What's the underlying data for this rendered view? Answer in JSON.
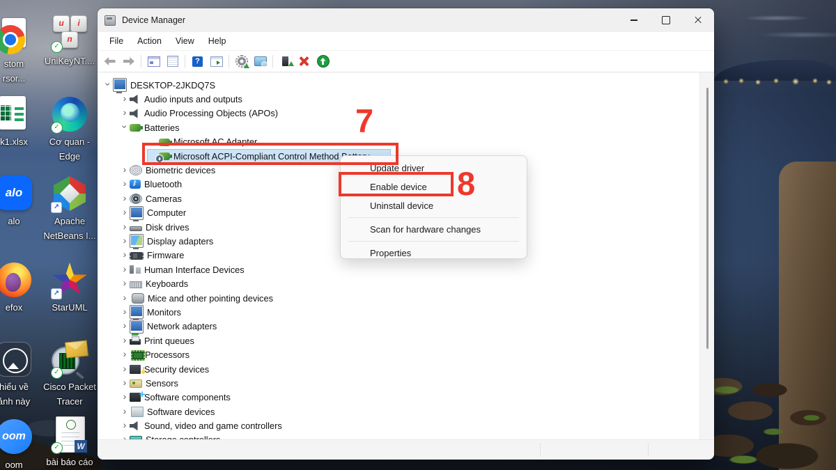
{
  "colors": {
    "annotation_red": "#ee382c",
    "selection_blue": "#cce4f7",
    "menu_bg": "#f9f9f9",
    "titlebar_bg": "#f0f0f0"
  },
  "annotations": {
    "step7": "7",
    "step8": "8"
  },
  "desktop": {
    "icons": [
      {
        "name": "custom-cursor-shortcut",
        "icon": "chrome-page-icon",
        "line1": "stom",
        "line2": "rsor..."
      },
      {
        "name": "unikey-shortcut",
        "icon": "unikey-keys-icon",
        "line1": "UniKeyNT....",
        "line2": "",
        "key1": "u",
        "key2": "i",
        "key3": "n"
      },
      {
        "name": "excel-file",
        "icon": "excel-file-icon",
        "line1": "k1.xlsx",
        "line2": ""
      },
      {
        "name": "edge-shortcut",
        "icon": "edge-icon",
        "line1": "Cơ quan -",
        "line2": "Edge"
      },
      {
        "name": "zalo-shortcut",
        "icon": "zalo-icon",
        "line1": "alo",
        "line2": "",
        "icon_text": "alo"
      },
      {
        "name": "netbeans-shortcut",
        "icon": "netbeans-cube-icon",
        "line1": "Apache",
        "line2": "NetBeans I..."
      },
      {
        "name": "firefox-shortcut",
        "icon": "firefox-icon",
        "line1": "efox",
        "line2": ""
      },
      {
        "name": "staruml-shortcut",
        "icon": "staruml-star-icon",
        "line1": "StarUML",
        "line2": ""
      },
      {
        "name": "photo-file",
        "icon": "photo-viewer-icon",
        "line1": "hiểu về",
        "line2": "ảnh này"
      },
      {
        "name": "cisco-packet-tracer-shortcut",
        "icon": "cisco-packet-tracer-icon",
        "line1": "Cisco Packet",
        "line2": "Tracer"
      },
      {
        "name": "zoom-shortcut",
        "icon": "zoom-icon",
        "line1": "oom",
        "line2": "",
        "icon_text": "oom"
      },
      {
        "name": "word-report-file",
        "icon": "word-document-icon",
        "line1": "bài báo cáo",
        "line2": "",
        "icon_text": "W"
      }
    ]
  },
  "window": {
    "title": "Device Manager",
    "menu_bar": [
      "File",
      "Action",
      "View",
      "Help"
    ],
    "toolbar": [
      {
        "icon": "back-arrow-icon"
      },
      {
        "icon": "forward-arrow-icon"
      },
      {
        "sep": true
      },
      {
        "icon": "console-tree-icon"
      },
      {
        "icon": "properties-icon"
      },
      {
        "sep": true
      },
      {
        "icon": "help-icon"
      },
      {
        "icon": "action-pane-icon"
      },
      {
        "sep": true
      },
      {
        "icon": "update-driver-icon"
      },
      {
        "icon": "scan-hardware-icon"
      },
      {
        "sep": true
      },
      {
        "icon": "device-update-icon"
      },
      {
        "icon": "uninstall-icon"
      },
      {
        "icon": "enable-icon"
      }
    ],
    "tree": {
      "items": [
        {
          "label": "DESKTOP-2JKDQ7S",
          "level": 0,
          "chevron": "down",
          "icon": "computer-icon"
        },
        {
          "label": "Audio inputs and outputs",
          "level": 1,
          "chevron": "right",
          "icon": "speaker-icon"
        },
        {
          "label": "Audio Processing Objects (APOs)",
          "level": 1,
          "chevron": "right",
          "icon": "speaker-icon"
        },
        {
          "label": "Batteries",
          "level": 1,
          "chevron": "down",
          "icon": "battery-icon"
        },
        {
          "label": "Microsoft AC Adapter",
          "level": 2,
          "chevron": "none",
          "icon": "battery-icon"
        },
        {
          "label": "Microsoft ACPI-Compliant Control Method Battery",
          "level": 2,
          "chevron": "none",
          "icon": "battery-disabled-icon",
          "selected": true
        },
        {
          "label": "Biometric devices",
          "level": 1,
          "chevron": "right",
          "icon": "fingerprint-icon"
        },
        {
          "label": "Bluetooth",
          "level": 1,
          "chevron": "right",
          "icon": "bluetooth-icon"
        },
        {
          "label": "Cameras",
          "level": 1,
          "chevron": "right",
          "icon": "camera-icon"
        },
        {
          "label": "Computer",
          "level": 1,
          "chevron": "right",
          "icon": "monitor-icon"
        },
        {
          "label": "Disk drives",
          "level": 1,
          "chevron": "right",
          "icon": "disk-icon"
        },
        {
          "label": "Display adapters",
          "level": 1,
          "chevron": "right",
          "icon": "display-adapter-icon"
        },
        {
          "label": "Firmware",
          "level": 1,
          "chevron": "right",
          "icon": "chip-icon"
        },
        {
          "label": "Human Interface Devices",
          "level": 1,
          "chevron": "right",
          "icon": "hid-icon"
        },
        {
          "label": "Keyboards",
          "level": 1,
          "chevron": "right",
          "icon": "keyboard-icon"
        },
        {
          "label": "Mice and other pointing devices",
          "level": 1,
          "chevron": "right",
          "icon": "mouse-icon"
        },
        {
          "label": "Monitors",
          "level": 1,
          "chevron": "right",
          "icon": "monitor-icon"
        },
        {
          "label": "Network adapters",
          "level": 1,
          "chevron": "right",
          "icon": "network-adapter-icon"
        },
        {
          "label": "Print queues",
          "level": 1,
          "chevron": "right",
          "icon": "printer-icon"
        },
        {
          "label": "Processors",
          "level": 1,
          "chevron": "right",
          "icon": "cpu-icon"
        },
        {
          "label": "Security devices",
          "level": 1,
          "chevron": "right",
          "icon": "security-key-icon"
        },
        {
          "label": "Sensors",
          "level": 1,
          "chevron": "right",
          "icon": "sensor-icon"
        },
        {
          "label": "Software components",
          "level": 1,
          "chevron": "right",
          "icon": "software-component-icon"
        },
        {
          "label": "Software devices",
          "level": 1,
          "chevron": "right",
          "icon": "software-device-icon"
        },
        {
          "label": "Sound, video and game controllers",
          "level": 1,
          "chevron": "right",
          "icon": "speaker-icon"
        },
        {
          "label": "Storage controllers",
          "level": 1,
          "chevron": "right",
          "icon": "storage-icon"
        }
      ]
    },
    "context_menu": {
      "items": [
        {
          "label": "Update driver"
        },
        {
          "label": "Enable device",
          "annotated": true
        },
        {
          "label": "Uninstall device"
        },
        {
          "separator": true
        },
        {
          "label": "Scan for hardware changes"
        },
        {
          "separator": true
        },
        {
          "label": "Properties"
        }
      ]
    }
  }
}
